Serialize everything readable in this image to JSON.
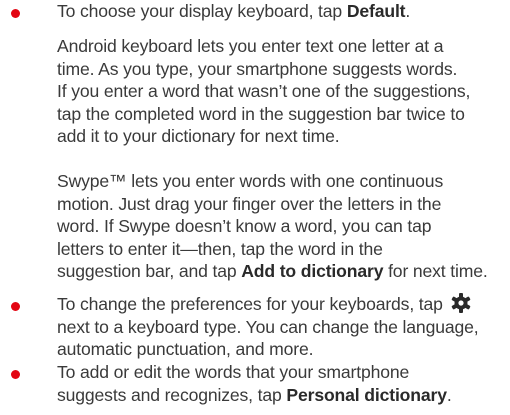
{
  "colors": {
    "bullet": "#e30613",
    "text": "#3a3a3a"
  },
  "icon": "gear-icon",
  "bullet1": {
    "pre": "To choose your display keyboard, tap ",
    "bold": "Default",
    "post": "."
  },
  "para_android": {
    "lines": [
      "Android keyboard lets you enter text one letter at a",
      "time. As you type, your smartphone suggests words.",
      "If you enter a word that wasn’t one of the suggestions,",
      "tap the completed word in the suggestion bar twice to",
      "add it to your dictionary for next time."
    ]
  },
  "para_swype": {
    "lines": [
      "Swype™ lets you enter words with one continuous",
      "motion. Just drag your finger over the letters in the",
      "word. If Swype doesn’t know a word, you can tap",
      "letters to enter it—then, tap the word in the"
    ],
    "last_pre": "suggestion bar, and tap ",
    "last_bold": "Add to dictionary",
    "last_post": " for next time."
  },
  "bullet2": {
    "l1_pre": "To change the preferences for your keyboards, tap",
    "l2": "next to a keyboard type. You can change the language,",
    "l3": "automatic punctuation, and more."
  },
  "bullet3": {
    "l1": "To add or edit the words that your smartphone",
    "l2_pre": "suggests and recognizes, tap ",
    "l2_bold": "Personal dictionary",
    "l2_post": "."
  }
}
